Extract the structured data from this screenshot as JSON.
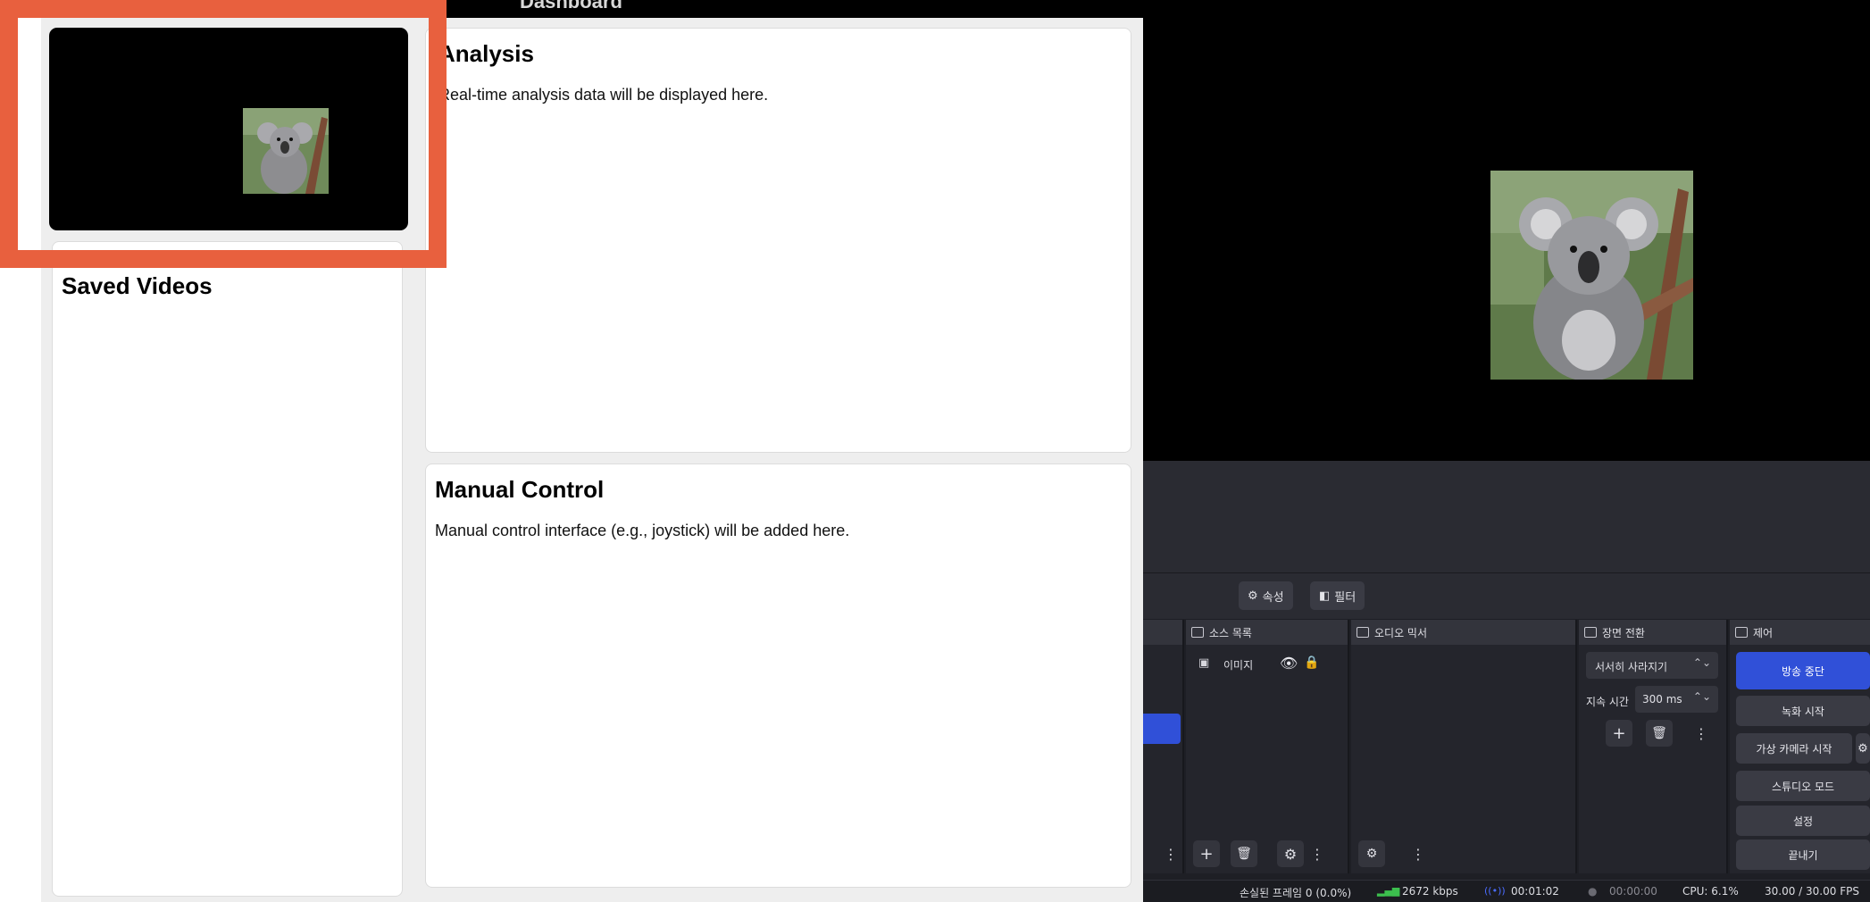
{
  "webapp": {
    "header_text": "Dashboard",
    "saved_videos": {
      "title": "Saved Videos"
    },
    "analysis": {
      "title": "Analysis",
      "description": "Real-time analysis data will be displayed here."
    },
    "manual_control": {
      "title": "Manual Control",
      "description": "Manual control interface (e.g., joystick) will be added here."
    }
  },
  "obs": {
    "toolbar": {
      "properties_label": "속성",
      "filters_label": "필터"
    },
    "docks": {
      "sources_title": "소스 목록",
      "audio_mixer_title": "오디오 믹서",
      "transitions_title": "장면 전환",
      "controls_title": "제어"
    },
    "sources": [
      {
        "name": "이미지"
      }
    ],
    "transitions": {
      "selected": "서서히 사라지기",
      "duration_label": "지속 시간",
      "duration_value": "300 ms"
    },
    "controls": {
      "stop_stream": "방송 중단",
      "start_recording": "녹화 시작",
      "start_virtual_camera": "가상 카메라 시작",
      "studio_mode": "스튜디오 모드",
      "settings": "설정",
      "exit": "끝내기"
    },
    "status": {
      "dropped_frames": "손실된 프레임 0 (0.0%)",
      "bitrate": "2672 kbps",
      "stream_time": "00:01:02",
      "record_time": "00:00:00",
      "cpu": "CPU: 6.1%",
      "fps": "30.00 / 30.00 FPS"
    },
    "colors": {
      "accent_blue": "#3050d8",
      "bitrate_green": "#3cbf4e",
      "stream_blue": "#4a6cff"
    }
  }
}
